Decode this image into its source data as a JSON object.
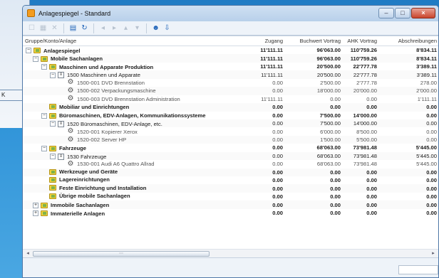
{
  "background_window": {
    "button_label": "K"
  },
  "window": {
    "title": "Anlagespiegel - Standard",
    "caption_buttons": [
      "minimize",
      "maximize",
      "close"
    ]
  },
  "toolbar": {
    "icons": [
      "new-icon",
      "grid-icon",
      "delete-icon",
      "tree-icon",
      "refresh-icon",
      "arrow-left-icon",
      "arrow-right-icon",
      "arrow-up-icon",
      "arrow-down-icon",
      "users-icon",
      "export-icon"
    ]
  },
  "table": {
    "headers": {
      "name": "Gruppe/Konto/Anlage",
      "zugang": "Zugang",
      "buchwert": "Buchwert Vortrag",
      "ahk": "AHK Vortrag",
      "abschreibungen": "Abschreibungen"
    },
    "rows": [
      {
        "level": 0,
        "kind": "group",
        "expander": "−",
        "bold": true,
        "name": "Anlagespiegel",
        "zugang": "11'111.11",
        "buchwert": "96'063.00",
        "ahk": "110'759.26",
        "abschr": "8'834.11"
      },
      {
        "level": 1,
        "kind": "group",
        "expander": "−",
        "bold": true,
        "name": "Mobile Sachanlagen",
        "zugang": "11'111.11",
        "buchwert": "96'063.00",
        "ahk": "110'759.26",
        "abschr": "8'834.11"
      },
      {
        "level": 2,
        "kind": "group",
        "expander": "−",
        "bold": true,
        "name": "Maschinen und Apparate Produktion",
        "zugang": "11'111.11",
        "buchwert": "20'500.00",
        "ahk": "22'777.78",
        "abschr": "3'389.11"
      },
      {
        "level": 3,
        "kind": "account",
        "expander": "−",
        "bold": false,
        "name": "1500 Maschinen und Apparate",
        "zugang": "11'111.11",
        "buchwert": "20'500.00",
        "ahk": "22'777.78",
        "abschr": "3'389.11"
      },
      {
        "level": 4,
        "kind": "asset",
        "expander": "",
        "bold": false,
        "name": "1500-001 DVD Brennstation",
        "zugang": "0.00",
        "buchwert": "2'500.00",
        "ahk": "2'777.78",
        "abschr": "278.00"
      },
      {
        "level": 4,
        "kind": "asset",
        "expander": "",
        "bold": false,
        "name": "1500-002 Verpackungsmaschine",
        "zugang": "0.00",
        "buchwert": "18'000.00",
        "ahk": "20'000.00",
        "abschr": "2'000.00"
      },
      {
        "level": 4,
        "kind": "asset",
        "expander": "",
        "bold": false,
        "name": "1500-003 DVD Brennstation Administration",
        "zugang": "11'111.11",
        "buchwert": "0.00",
        "ahk": "0.00",
        "abschr": "1'111.11"
      },
      {
        "level": 2,
        "kind": "group",
        "expander": "",
        "bold": true,
        "name": "Mobiliar und Einrichtungen",
        "zugang": "0.00",
        "buchwert": "0.00",
        "ahk": "0.00",
        "abschr": "0.00"
      },
      {
        "level": 2,
        "kind": "group",
        "expander": "−",
        "bold": true,
        "name": "Büromaschinen, EDV-Anlagen, Kommunikationssysteme",
        "zugang": "0.00",
        "buchwert": "7'500.00",
        "ahk": "14'000.00",
        "abschr": "0.00"
      },
      {
        "level": 3,
        "kind": "account",
        "expander": "−",
        "bold": false,
        "name": "1520 Büromaschinen, EDV-Anlage, etc.",
        "zugang": "0.00",
        "buchwert": "7'500.00",
        "ahk": "14'000.00",
        "abschr": "0.00"
      },
      {
        "level": 4,
        "kind": "asset",
        "expander": "",
        "bold": false,
        "name": "1520-001 Kopierer Xerox",
        "zugang": "0.00",
        "buchwert": "6'000.00",
        "ahk": "8'500.00",
        "abschr": "0.00"
      },
      {
        "level": 4,
        "kind": "asset",
        "expander": "",
        "bold": false,
        "name": "1520-002 Server HP",
        "zugang": "0.00",
        "buchwert": "1'500.00",
        "ahk": "5'500.00",
        "abschr": "0.00"
      },
      {
        "level": 2,
        "kind": "group",
        "expander": "−",
        "bold": true,
        "name": "Fahrzeuge",
        "zugang": "0.00",
        "buchwert": "68'063.00",
        "ahk": "73'981.48",
        "abschr": "5'445.00"
      },
      {
        "level": 3,
        "kind": "account",
        "expander": "−",
        "bold": false,
        "name": "1530 Fahrzeuge",
        "zugang": "0.00",
        "buchwert": "68'063.00",
        "ahk": "73'981.48",
        "abschr": "5'445.00"
      },
      {
        "level": 4,
        "kind": "asset",
        "expander": "",
        "bold": false,
        "name": "1530-001 Audi A6 Quattro Allrad",
        "zugang": "0.00",
        "buchwert": "68'063.00",
        "ahk": "73'981.48",
        "abschr": "5'445.00"
      },
      {
        "level": 2,
        "kind": "group",
        "expander": "",
        "bold": true,
        "name": "Werkzeuge und Geräte",
        "zugang": "0.00",
        "buchwert": "0.00",
        "ahk": "0.00",
        "abschr": "0.00"
      },
      {
        "level": 2,
        "kind": "group",
        "expander": "",
        "bold": true,
        "name": "Lagereinrichtungen",
        "zugang": "0.00",
        "buchwert": "0.00",
        "ahk": "0.00",
        "abschr": "0.00"
      },
      {
        "level": 2,
        "kind": "group",
        "expander": "",
        "bold": true,
        "name": "Feste Einrichtung und Installation",
        "zugang": "0.00",
        "buchwert": "0.00",
        "ahk": "0.00",
        "abschr": "0.00"
      },
      {
        "level": 2,
        "kind": "group",
        "expander": "",
        "bold": true,
        "name": "Übrige mobile Sachanlagen",
        "zugang": "0.00",
        "buchwert": "0.00",
        "ahk": "0.00",
        "abschr": "0.00"
      },
      {
        "level": 1,
        "kind": "group",
        "expander": "+",
        "bold": true,
        "name": "Immobile Sachanlagen",
        "zugang": "0.00",
        "buchwert": "0.00",
        "ahk": "0.00",
        "abschr": "0.00"
      },
      {
        "level": 1,
        "kind": "group",
        "expander": "+",
        "bold": true,
        "name": "Immaterielle Anlagen",
        "zugang": "0.00",
        "buchwert": "0.00",
        "ahk": "0.00",
        "abschr": "0.00"
      }
    ]
  },
  "colors": {
    "accent": "#1f63b8",
    "folder": "#f2d33c",
    "close_button": "#c9442c"
  }
}
